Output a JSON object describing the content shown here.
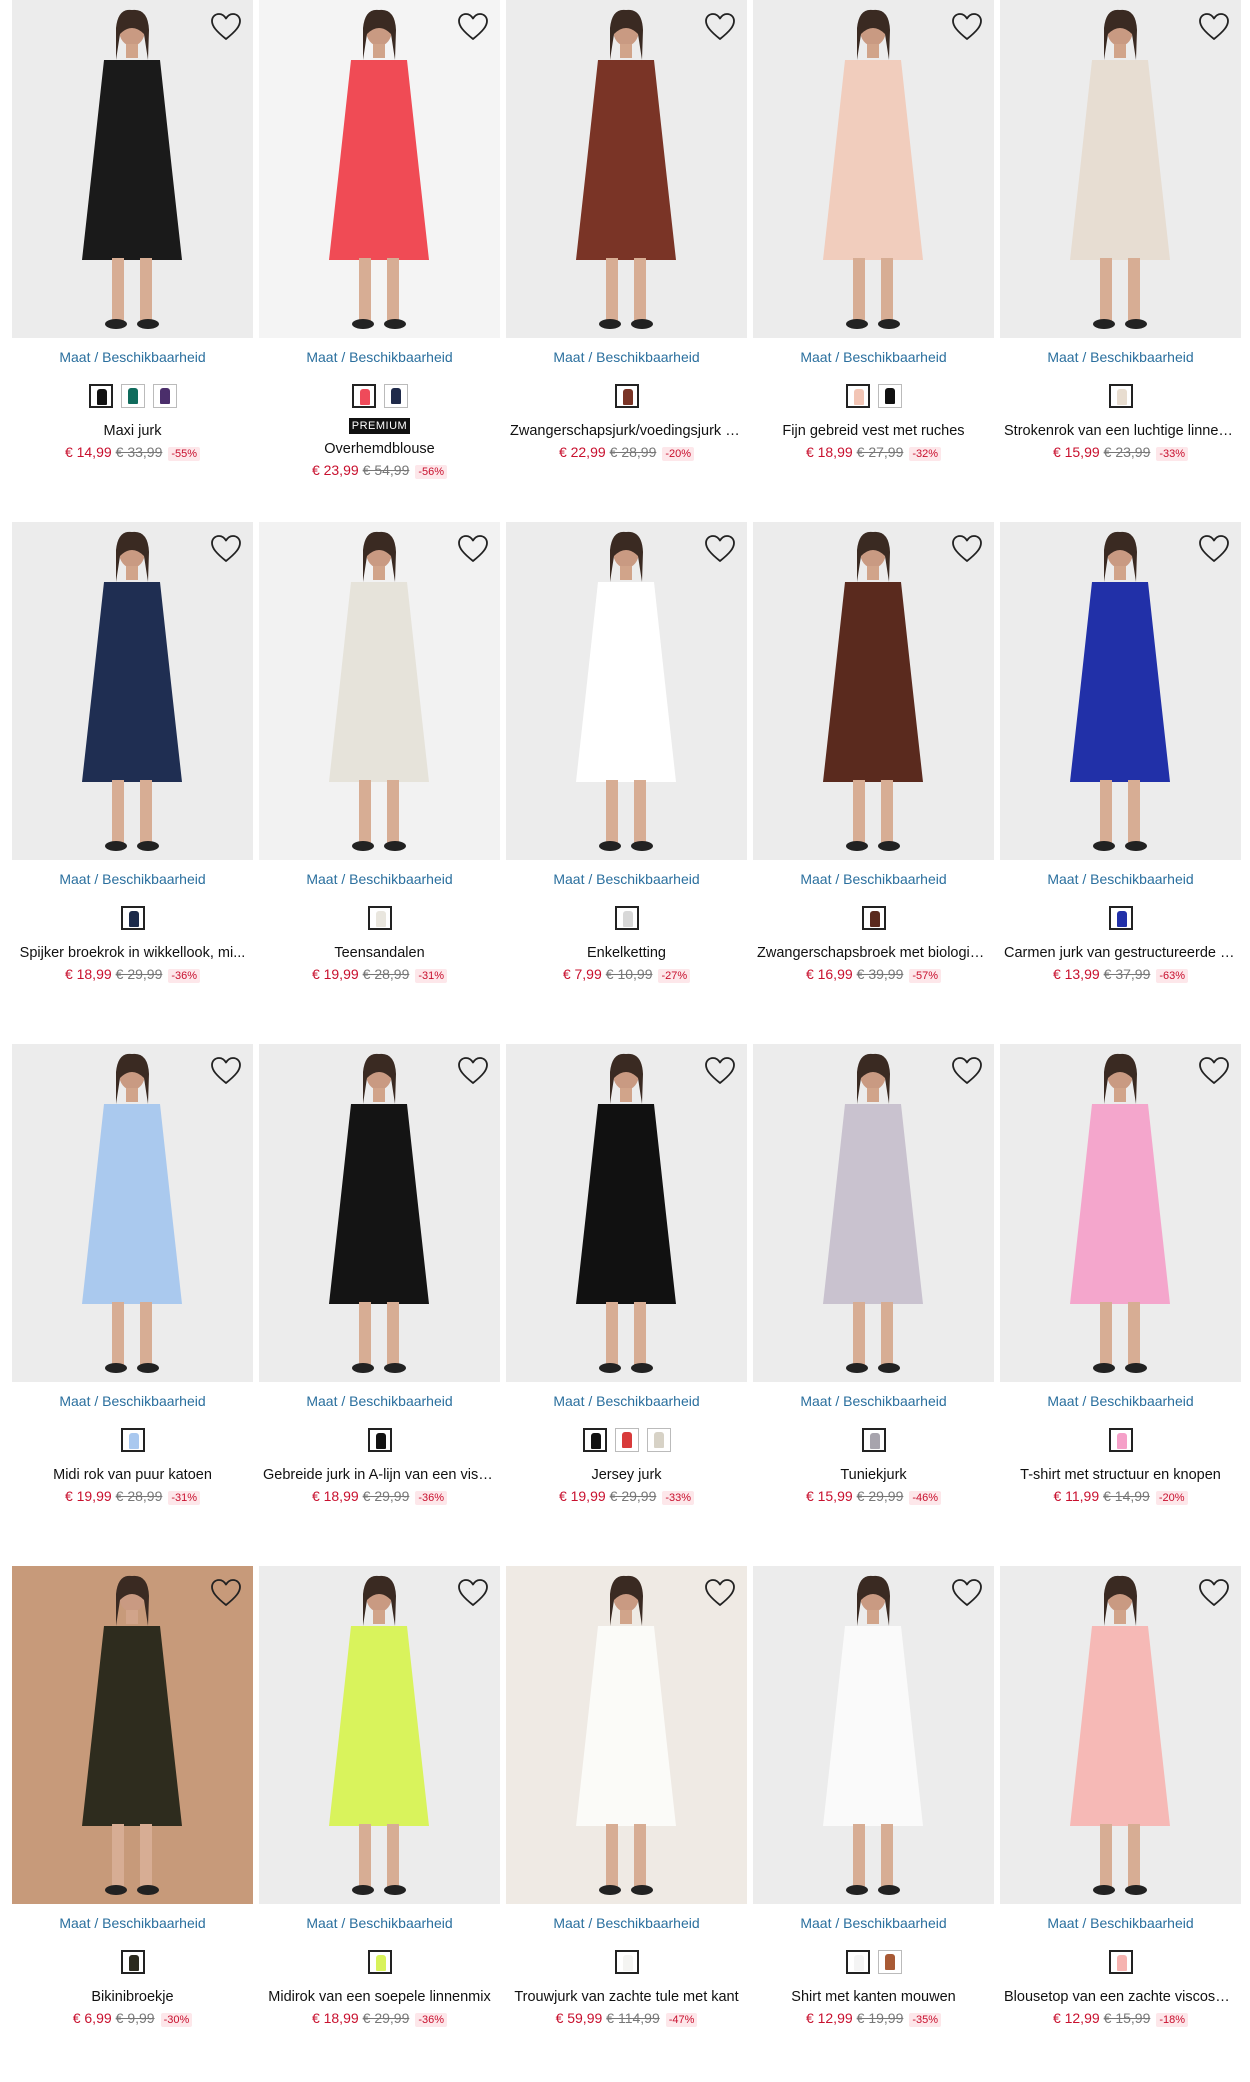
{
  "labels": {
    "maat": "Maat",
    "separator": " / ",
    "availability": "Beschikbaarheid"
  },
  "colors": {
    "link": "#2a6f9e",
    "price_new": "#c8102e",
    "price_old": "#777777",
    "discount_bg": "#fde7ea"
  },
  "products": [
    {
      "title": "Maxi jurk",
      "price": "€ 14,99",
      "old_price": "€ 33,99",
      "discount": "-55%",
      "swatches": [
        "#111111",
        "#0f6b5c",
        "#4b2e6b"
      ],
      "photo_bg": "#ececec",
      "garment": "#1a1a1a",
      "premium": ""
    },
    {
      "title": "Overhemdblouse",
      "price": "€ 23,99",
      "old_price": "€ 54,99",
      "discount": "-56%",
      "swatches": [
        "#ef4a5a",
        "#1f2a4a"
      ],
      "photo_bg": "#f4f4f4",
      "garment": "#f04b55",
      "premium": "PREMIUM"
    },
    {
      "title": "Zwangerschapsjurk/voedingsjurk v...",
      "price": "€ 22,99",
      "old_price": "€ 28,99",
      "discount": "-20%",
      "swatches": [
        "#7a3426"
      ],
      "photo_bg": "#ececec",
      "garment": "#7a3426",
      "premium": ""
    },
    {
      "title": "Fijn gebreid vest met ruches",
      "price": "€ 18,99",
      "old_price": "€ 27,99",
      "discount": "-32%",
      "swatches": [
        "#f2c5b5",
        "#111111"
      ],
      "photo_bg": "#ececec",
      "garment": "#f1cdbd",
      "premium": ""
    },
    {
      "title": "Strokenrok van een luchtige linnen...",
      "price": "€ 15,99",
      "old_price": "€ 23,99",
      "discount": "-33%",
      "swatches": [
        "#e8ddd0"
      ],
      "photo_bg": "#ececec",
      "garment": "#e7ddd2",
      "premium": ""
    },
    {
      "title": "Spijker broekrok in wikkellook, mi...",
      "price": "€ 18,99",
      "old_price": "€ 29,99",
      "discount": "-36%",
      "swatches": [
        "#1b2a4a"
      ],
      "photo_bg": "#ececec",
      "garment": "#1f2e52",
      "premium": ""
    },
    {
      "title": "Teensandalen",
      "price": "€ 19,99",
      "old_price": "€ 28,99",
      "discount": "-31%",
      "swatches": [
        "#e9e6de"
      ],
      "photo_bg": "#f2f2f2",
      "garment": "#e6e3da",
      "premium": ""
    },
    {
      "title": "Enkelketting",
      "price": "€ 7,99",
      "old_price": "€ 10,99",
      "discount": "-27%",
      "swatches": [
        "#d8d8d8"
      ],
      "photo_bg": "#ececec",
      "garment": "#ffffff",
      "premium": ""
    },
    {
      "title": "Zwangerschapsbroek met biologisc...",
      "price": "€ 16,99",
      "old_price": "€ 39,99",
      "discount": "-57%",
      "swatches": [
        "#5a2a1e"
      ],
      "photo_bg": "#ececec",
      "garment": "#5a2a1e",
      "premium": ""
    },
    {
      "title": "Carmen jurk van gestructureerde c...",
      "price": "€ 13,99",
      "old_price": "€ 37,99",
      "discount": "-63%",
      "swatches": [
        "#2130a8"
      ],
      "photo_bg": "#ececec",
      "garment": "#2130a8",
      "premium": ""
    },
    {
      "title": "Midi rok van puur katoen",
      "price": "€ 19,99",
      "old_price": "€ 28,99",
      "discount": "-31%",
      "swatches": [
        "#a9c8ef"
      ],
      "photo_bg": "#ececec",
      "garment": "#aac9ee",
      "premium": ""
    },
    {
      "title": "Gebreide jurk in A-lijn van een visc...",
      "price": "€ 18,99",
      "old_price": "€ 29,99",
      "discount": "-36%",
      "swatches": [
        "#111111"
      ],
      "photo_bg": "#ececec",
      "garment": "#141414",
      "premium": ""
    },
    {
      "title": "Jersey jurk",
      "price": "€ 19,99",
      "old_price": "€ 29,99",
      "discount": "-33%",
      "swatches": [
        "#111111",
        "#d83a3a",
        "#d7d2c6"
      ],
      "photo_bg": "#ececec",
      "garment": "#111111",
      "premium": ""
    },
    {
      "title": "Tuniekjurk",
      "price": "€ 15,99",
      "old_price": "€ 29,99",
      "discount": "-46%",
      "swatches": [
        "#a7a4ad"
      ],
      "photo_bg": "#ececec",
      "garment": "#c9c2cf",
      "premium": ""
    },
    {
      "title": "T-shirt met structuur en knopen",
      "price": "€ 11,99",
      "old_price": "€ 14,99",
      "discount": "-20%",
      "swatches": [
        "#f5a0c8"
      ],
      "photo_bg": "#ececec",
      "garment": "#f4a6cc",
      "premium": ""
    },
    {
      "title": "Bikinibroekje",
      "price": "€ 6,99",
      "old_price": "€ 9,99",
      "discount": "-30%",
      "swatches": [
        "#2b2a1e"
      ],
      "photo_bg": "#c79a7a",
      "garment": "#2e2c1e",
      "premium": ""
    },
    {
      "title": "Midirok van een soepele linnenmix",
      "price": "€ 18,99",
      "old_price": "€ 29,99",
      "discount": "-36%",
      "swatches": [
        "#d8f25a"
      ],
      "photo_bg": "#ececec",
      "garment": "#d9f35c",
      "premium": ""
    },
    {
      "title": "Trouwjurk van zachte tule met kant",
      "price": "€ 59,99",
      "old_price": "€ 114,99",
      "discount": "-47%",
      "swatches": [
        "#f4f4f2"
      ],
      "photo_bg": "#efeae4",
      "garment": "#fbfbf8",
      "premium": ""
    },
    {
      "title": "Shirt met kanten mouwen",
      "price": "€ 12,99",
      "old_price": "€ 19,99",
      "discount": "-35%",
      "swatches": [
        "#f4f4f4",
        "#a85a35"
      ],
      "photo_bg": "#ececec",
      "garment": "#fafafa",
      "premium": ""
    },
    {
      "title": "Blousetop van een zachte viscose-mix",
      "price": "€ 12,99",
      "old_price": "€ 15,99",
      "discount": "-18%",
      "swatches": [
        "#f6b3b0"
      ],
      "photo_bg": "#ececec",
      "garment": "#f6b9b6",
      "premium": ""
    }
  ]
}
